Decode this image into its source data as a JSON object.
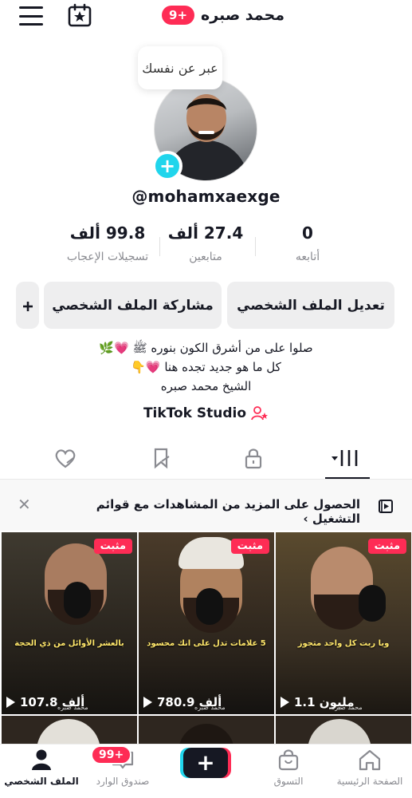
{
  "header": {
    "name": "محمد صبره",
    "notif_badge": "9+"
  },
  "bubble_text": "عبر عن نفسك",
  "profile": {
    "username": "@mohamxaexge"
  },
  "stats": [
    {
      "value": "0",
      "label": "أتابعه"
    },
    {
      "value": "27.4 ألف",
      "label": "متابعين"
    },
    {
      "value": "99.8 ألف",
      "label": "تسجيلات الإعجاب"
    }
  ],
  "buttons": {
    "edit": "تعديل الملف الشخصي",
    "share": "مشاركة الملف الشخصي"
  },
  "bio": {
    "line1": "صلوا على من أشرق الكون بنوره ﷺ 💗🌿",
    "line2": "كل ما هو جديد تجده هنا 💗👇",
    "line3": "الشيخ محمد صبره"
  },
  "studio_label": "TikTok Studio",
  "playlist_banner": "الحصول على المزيد من المشاهدات مع قوائم التشغيل ›",
  "videos": [
    {
      "pinned": "مثبت",
      "caption": "ويا ربت كل واحد متجوز",
      "views": "1.1 مليون",
      "watermark": "محمد صبره"
    },
    {
      "pinned": "مثبت",
      "caption": "5 علامات تدل على انك محسود",
      "views": "780.9 ألف",
      "watermark": "محمد صبره"
    },
    {
      "pinned": "مثبت",
      "caption": "بالعشر الأوائل من ذي الحجة",
      "views": "107.8 ألف",
      "watermark": "محمد صبره"
    }
  ],
  "nav": {
    "home": "الصفحة الرئيسية",
    "shop": "التسوق",
    "inbox": "صندوق الوارد",
    "inbox_badge": "99+",
    "profile": "الملف الشخصي"
  },
  "colors": {
    "accent": "#fe2c55",
    "cyan": "#20d5ec",
    "text": "#161823",
    "muted": "#8a8b91"
  }
}
